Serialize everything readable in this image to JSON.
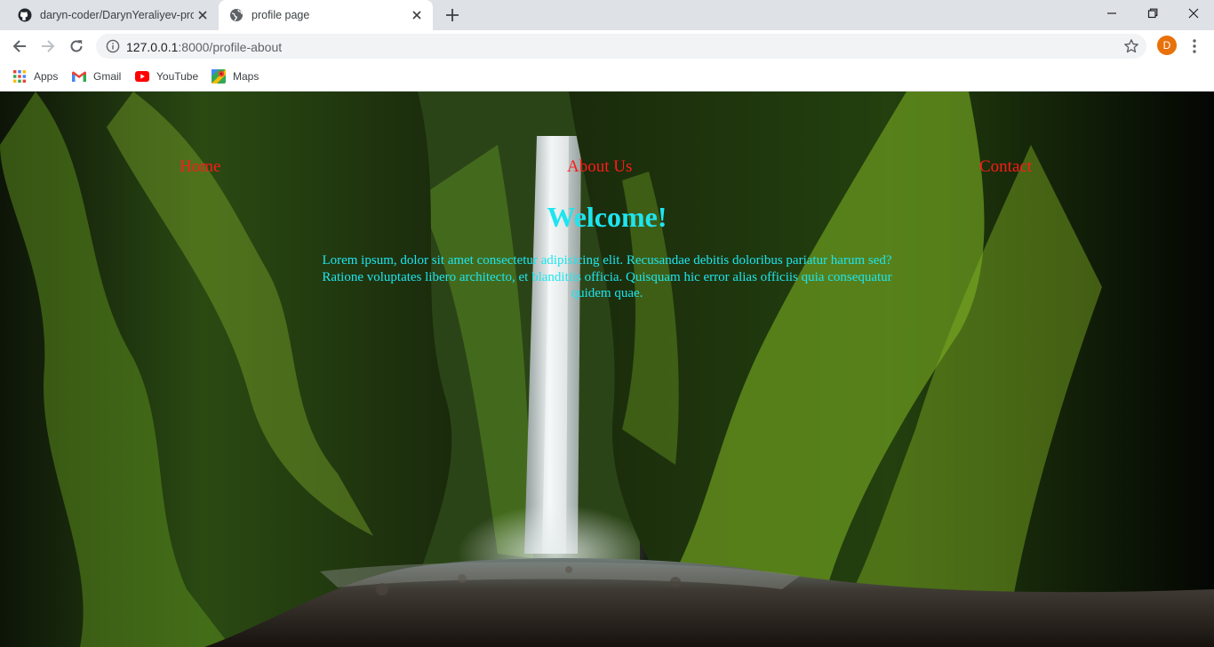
{
  "browser": {
    "tabs": [
      {
        "title": "daryn-coder/DarynYeraliyev-profile",
        "icon": "github-icon",
        "active": false
      },
      {
        "title": "profile page",
        "icon": "globe-icon",
        "active": true
      }
    ],
    "address": {
      "host": "127.0.0.1",
      "path": ":8000/profile-about"
    },
    "profile_initial": "D",
    "bookmarks": [
      {
        "label": "Apps",
        "icon": "apps-grid-icon"
      },
      {
        "label": "Gmail",
        "icon": "gmail-icon"
      },
      {
        "label": "YouTube",
        "icon": "youtube-icon"
      },
      {
        "label": "Maps",
        "icon": "maps-icon"
      }
    ]
  },
  "page": {
    "nav": {
      "home": "Home",
      "about": "About Us",
      "contact": "Contact"
    },
    "heading": "Welcome!",
    "body": "Lorem ipsum, dolor sit amet consectetur adipisicing elit. Recusandae debitis doloribus pariatur harum sed? Ratione voluptates libero architecto, et blanditiis officia. Quisquam hic error alias officiis quia consequatur quidem quae.",
    "background": "mossy canyon waterfall photo"
  },
  "colors": {
    "nav_link": "#ff1a1a",
    "heading_text": "#1ee5f0",
    "avatar": "#e8710a",
    "tabstrip": "#dee1e6"
  }
}
